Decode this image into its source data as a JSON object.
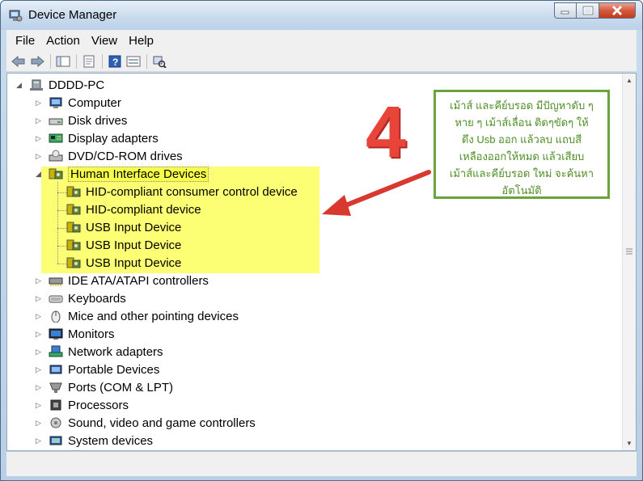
{
  "window": {
    "title": "Device Manager"
  },
  "menu": [
    "File",
    "Action",
    "View",
    "Help"
  ],
  "tree": {
    "root": "DDDD-PC",
    "categories": [
      {
        "label": "Computer",
        "icon": "computer-icon"
      },
      {
        "label": "Disk drives",
        "icon": "disk-drive-icon"
      },
      {
        "label": "Display adapters",
        "icon": "display-adapter-icon"
      },
      {
        "label": "DVD/CD-ROM drives",
        "icon": "dvd-drive-icon"
      },
      {
        "label": "Human Interface Devices",
        "icon": "hid-icon",
        "expanded": true,
        "children": [
          "HID-compliant consumer control device",
          "HID-compliant device",
          "USB Input Device",
          "USB Input Device",
          "USB Input Device"
        ]
      },
      {
        "label": "IDE ATA/ATAPI controllers",
        "icon": "ide-controller-icon"
      },
      {
        "label": "Keyboards",
        "icon": "keyboard-icon"
      },
      {
        "label": "Mice and other pointing devices",
        "icon": "mouse-icon"
      },
      {
        "label": "Monitors",
        "icon": "monitor-icon"
      },
      {
        "label": "Network adapters",
        "icon": "network-adapter-icon"
      },
      {
        "label": "Portable Devices",
        "icon": "portable-device-icon"
      },
      {
        "label": "Ports (COM & LPT)",
        "icon": "port-icon"
      },
      {
        "label": "Processors",
        "icon": "processor-icon"
      },
      {
        "label": "Sound, video and game controllers",
        "icon": "sound-icon"
      },
      {
        "label": "System devices",
        "icon": "system-device-icon"
      }
    ]
  },
  "annotation": {
    "number": "4",
    "lines": [
      "เม้าส์ และคีย์บรอด มีปัญหาดับ ๆ",
      "หาย ๆ เม้าส์เลื่อน ติดๆขัดๆ ให้",
      "ดึง Usb ออก แล้วลบ แถบสี",
      "เหลืองออกให้หมด แล้วเสียบ",
      "เม้าส์และคีย์บรอด ใหม่ จะค้นหา",
      "อัตโนมัติ"
    ],
    "text_color": "#4f8e26",
    "number_color": "#e8443a",
    "highlight_color": "#fcff5a"
  }
}
